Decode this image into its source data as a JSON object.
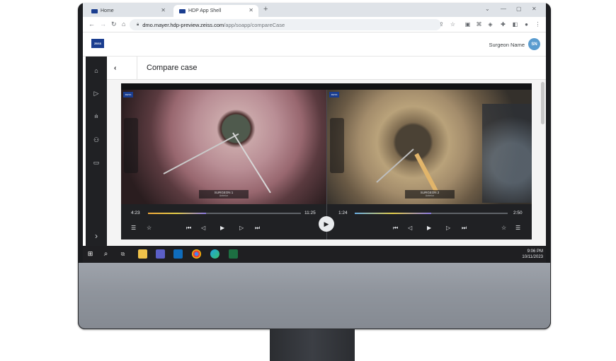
{
  "browser": {
    "tabs": [
      {
        "label": "Home"
      },
      {
        "label": "HDP App Shell"
      }
    ],
    "url_host": "dmo.mayer.hdp-preview.zeiss.com",
    "url_path": "/app/soapp/compareCase"
  },
  "header": {
    "logo_text": "ZEISS",
    "user_name": "Surgeon Name",
    "user_initials": "SN"
  },
  "sidebar": {
    "items": [
      {
        "icon": "home-icon",
        "glyph": "⌂"
      },
      {
        "icon": "play-icon",
        "glyph": "▷"
      },
      {
        "icon": "bar-chart-icon",
        "glyph": "ılı"
      },
      {
        "icon": "user-settings-icon",
        "glyph": "⚇"
      },
      {
        "icon": "chat-icon",
        "glyph": "▭"
      },
      {
        "icon": "expand-icon",
        "glyph": "›"
      }
    ]
  },
  "page": {
    "title": "Compare case",
    "back_glyph": "‹"
  },
  "videos": {
    "left": {
      "surgeon": "SURGEON 1",
      "sub": "Anterior",
      "current_time": "4:23",
      "total_time": "11:25",
      "progress": 0.38
    },
    "right": {
      "surgeon": "SURGEON 2",
      "sub": "Anterior",
      "current_time": "1:24",
      "total_time": "2:50",
      "progress": 0.5
    }
  },
  "controls": {
    "list_glyph": "☰",
    "star_glyph": "☆",
    "skip_start_glyph": "⏮",
    "step_back_glyph": "◁",
    "play_glyph": "▶",
    "step_forward_glyph": "▷",
    "skip_end_glyph": "⏭"
  },
  "taskbar": {
    "time": "9:06 PM",
    "date": "10/11/2023"
  },
  "colors": {
    "accent": "#1a3d8f",
    "avatar": "#5a9ccf",
    "sidebar": "#202124",
    "player": "#202124"
  }
}
